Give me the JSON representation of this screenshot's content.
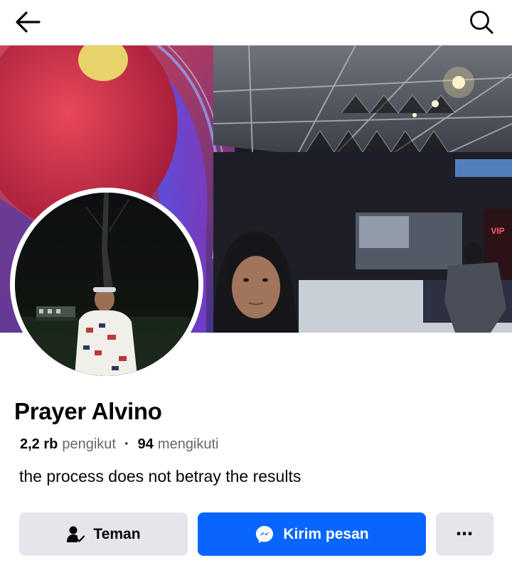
{
  "profile": {
    "name": "Prayer Alvino",
    "followers_count": "2,2 rb",
    "followers_label": "pengikut",
    "following_count": "94",
    "following_label": "mengikuti",
    "bio": "the process does not betray the results"
  },
  "actions": {
    "friend_label": "Teman",
    "message_label": "Kirim pesan",
    "more_label": "⋯"
  },
  "cover": {
    "sign_text": "VIP"
  },
  "icons": {
    "back": "arrow-left-icon",
    "search": "search-icon",
    "friend": "friend-check-icon",
    "messenger": "messenger-icon",
    "more": "more-dots-icon"
  },
  "colors": {
    "primary_button": "#0866ff",
    "secondary_button": "#e4e6eb",
    "text": "#050505",
    "secondary_text": "#65676b"
  }
}
